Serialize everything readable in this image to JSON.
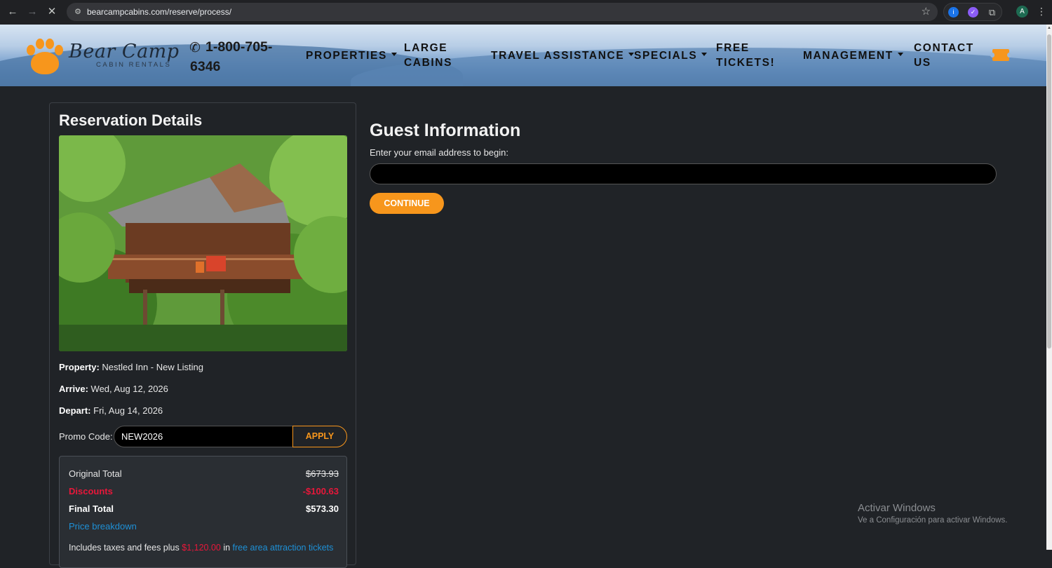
{
  "browser": {
    "url": "bearcampcabins.com/reserve/process/",
    "profile_initial": "A",
    "extension_1_label": "i"
  },
  "header": {
    "brand_name": "Bear Camp",
    "brand_sub": "CABIN RENTALS",
    "phone": "1-800-705-6346",
    "menu": {
      "properties": "PROPERTIES",
      "large_cabins": "LARGE CABINS",
      "travel_assistance": "TRAVEL ASSISTANCE",
      "specials": "SPECIALS",
      "free_tickets": "FREE TICKETS!",
      "management": "MANAGEMENT",
      "contact_us": "CONTACT US"
    },
    "accent_color": "#f7961c"
  },
  "reservation": {
    "title": "Reservation Details",
    "property_label": "Property:",
    "property_value": "Nestled Inn - New Listing",
    "arrive_label": "Arrive:",
    "arrive_value": "Wed, Aug 12, 2026",
    "depart_label": "Depart:",
    "depart_value": "Fri, Aug 14, 2026",
    "promo_label": "Promo Code:",
    "promo_value": "NEW2026",
    "apply_label": "APPLY",
    "totals": {
      "original_label": "Original Total",
      "original_value": "$673.93",
      "discounts_label": "Discounts",
      "discounts_value": "-$100.63",
      "final_label": "Final Total",
      "final_value": "$573.30",
      "price_breakdown": "Price breakdown",
      "tax_note_prefix": "Includes taxes and fees plus",
      "tax_note_amount": "$1,120.00",
      "tax_note_mid": "in",
      "tax_note_link": "free area attraction tickets"
    }
  },
  "guest": {
    "title": "Guest Information",
    "email_label": "Enter your email address to begin:",
    "email_value": "",
    "continue_label": "CONTINUE"
  },
  "watermark": {
    "title": "Activar Windows",
    "subtitle": "Ve a Configuración para activar Windows."
  }
}
